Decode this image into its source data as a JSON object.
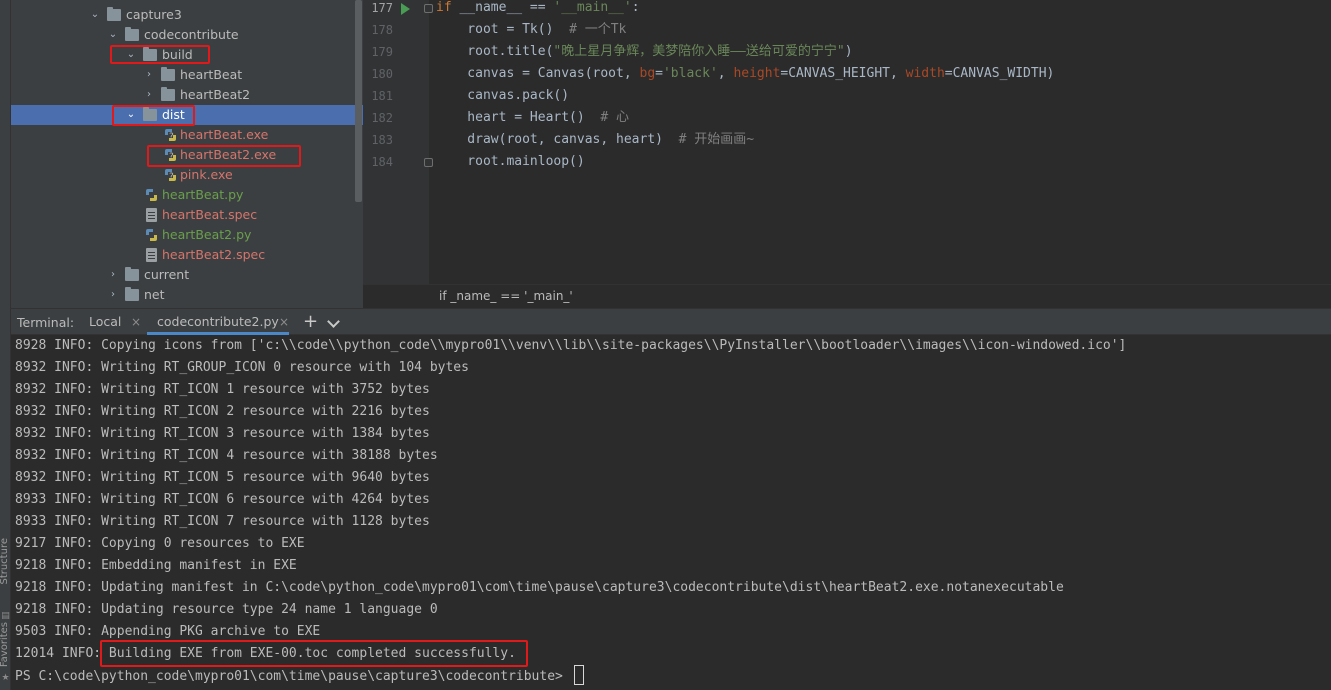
{
  "project_tree": {
    "rows": [
      {
        "label": "capture3",
        "kind": "folder",
        "color": "normal",
        "expanded": true
      },
      {
        "label": "codecontribute",
        "kind": "folder",
        "color": "normal",
        "expanded": true
      },
      {
        "label": "build",
        "kind": "folder",
        "color": "normal",
        "expanded": true
      },
      {
        "label": "heartBeat",
        "kind": "folder",
        "color": "normal",
        "expanded": false
      },
      {
        "label": "heartBeat2",
        "kind": "folder",
        "color": "normal",
        "expanded": false
      },
      {
        "label": "dist",
        "kind": "folder",
        "color": "white",
        "expanded": true,
        "selected": true
      },
      {
        "label": "heartBeat.exe",
        "kind": "exe",
        "color": "red"
      },
      {
        "label": "heartBeat2.exe",
        "kind": "exe",
        "color": "red"
      },
      {
        "label": "pink.exe",
        "kind": "exe",
        "color": "red"
      },
      {
        "label": "heartBeat.py",
        "kind": "py",
        "color": "green"
      },
      {
        "label": "heartBeat.spec",
        "kind": "spec",
        "color": "red"
      },
      {
        "label": "heartBeat2.py",
        "kind": "py",
        "color": "green"
      },
      {
        "label": "heartBeat2.spec",
        "kind": "spec",
        "color": "red"
      },
      {
        "label": "current",
        "kind": "folder",
        "color": "normal",
        "expanded": false
      },
      {
        "label": "net",
        "kind": "folder",
        "color": "normal",
        "expanded": false
      }
    ]
  },
  "editor": {
    "line_numbers": [
      "177",
      "178",
      "179",
      "180",
      "181",
      "182",
      "183",
      "184"
    ],
    "code": {
      "l177": {
        "if": "if",
        "name": " __name__",
        "eq": " == ",
        "str": "'__main__'",
        "colon": ":"
      },
      "l178": {
        "code": "    root = Tk()  ",
        "comment": "# 一个Tk"
      },
      "l179": {
        "pre": "    root.title(",
        "str": "\"晚上星月争辉，美梦陪你入睡——送给可爱的宁宁\"",
        "post": ")"
      },
      "l180": {
        "pre": "    canvas = Canvas(root, ",
        "bg": "bg",
        "bg_eq": "=",
        "bg_val": "'black'",
        "sep1": ", ",
        "height": "height",
        "height_val": "=CANVAS_HEIGHT, ",
        "width": "width",
        "width_val": "=CANVAS_WIDTH)"
      },
      "l181": {
        "code": "    canvas.pack()"
      },
      "l182": {
        "code": "    heart = Heart()  ",
        "comment": "# 心"
      },
      "l183": {
        "code": "    draw(root, canvas, heart)  ",
        "comment": "# 开始画画~"
      },
      "l184": {
        "code": "    root.mainloop()"
      }
    },
    "breadcrumb": "if _name_ == '_main_'"
  },
  "terminal_tabs": {
    "title": "Terminal:",
    "tabs": [
      {
        "label": "Local",
        "active": false
      },
      {
        "label": "codecontribute2.py",
        "active": true
      }
    ],
    "close_glyph": "×",
    "plus_glyph": "+"
  },
  "terminal": {
    "lines": [
      "8928 INFO: Copying icons from ['c:\\\\code\\\\python_code\\\\mypro01\\\\venv\\\\lib\\\\site-packages\\\\PyInstaller\\\\bootloader\\\\images\\\\icon-windowed.ico']",
      "8932 INFO: Writing RT_GROUP_ICON 0 resource with 104 bytes",
      "8932 INFO: Writing RT_ICON 1 resource with 3752 bytes",
      "8932 INFO: Writing RT_ICON 2 resource with 2216 bytes",
      "8932 INFO: Writing RT_ICON 3 resource with 1384 bytes",
      "8932 INFO: Writing RT_ICON 4 resource with 38188 bytes",
      "8932 INFO: Writing RT_ICON 5 resource with 9640 bytes",
      "8933 INFO: Writing RT_ICON 6 resource with 4264 bytes",
      "8933 INFO: Writing RT_ICON 7 resource with 1128 bytes",
      "9217 INFO: Copying 0 resources to EXE",
      "9218 INFO: Embedding manifest in EXE",
      "9218 INFO: Updating manifest in C:\\code\\python_code\\mypro01\\com\\time\\pause\\capture3\\codecontribute\\dist\\heartBeat2.exe.notanexecutable",
      "9218 INFO: Updating resource type 24 name 1 language 0",
      "9503 INFO: Appending PKG archive to EXE",
      "12014 INFO: Building EXE from EXE-00.toc completed successfully."
    ],
    "prompt": "PS C:\\code\\python_code\\mypro01\\com\\time\\pause\\capture3\\codecontribute> "
  },
  "side_tabs": {
    "structure": "Structure",
    "favorites": "Favorites"
  },
  "colors": {
    "tree_bg": "#3c3f41",
    "editor_bg": "#2b2b2b",
    "selection": "#4b6eaf",
    "highlight_box": "#e0191a"
  }
}
